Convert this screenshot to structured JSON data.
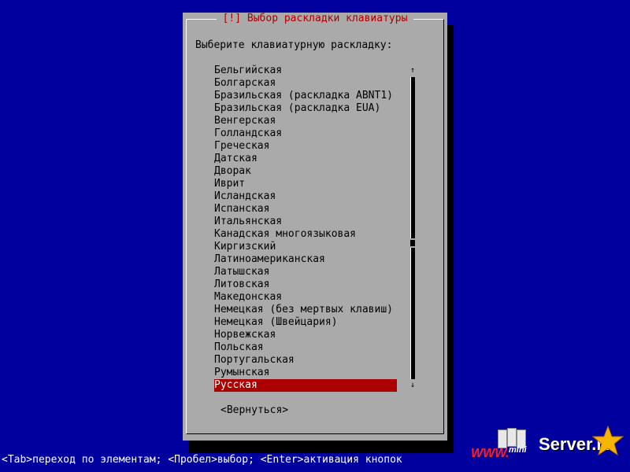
{
  "dialog": {
    "title": "[!] Выбор раскладки клавиатуры",
    "prompt": "Выберите клавиатурную раскладку:",
    "items": [
      "Бельгийская",
      "Болгарская",
      "Бразильская (раскладка ABNT1)",
      "Бразильская (раскладка EUA)",
      "Венгерская",
      "Голландская",
      "Греческая",
      "Датская",
      "Дворак",
      "Иврит",
      "Исландская",
      "Испанская",
      "Итальянская",
      "Канадская многоязыковая",
      "Киргизский",
      "Латиноамериканская",
      "Латышская",
      "Литовская",
      "Македонская",
      "Немецкая (без мертвых клавиш)",
      "Немецкая (Швейцария)",
      "Норвежская",
      "Польская",
      "Португальская",
      "Румынская",
      "Русская"
    ],
    "selected_item": "Русская",
    "scroll_up_glyph": "↑",
    "scroll_down_glyph": "↓",
    "scroll_position": 0.55,
    "back_button": "<Вернуться>"
  },
  "status_bar": {
    "text": "<Tab>переход по элементам; <Пробел>выбор; <Enter>активация кнопок"
  },
  "watermark": {
    "www": "WWW.",
    "mini": "mini",
    "server": "Server.ru",
    "server_icon": "server-rack-icon",
    "star_icon": "star-icon"
  },
  "colors": {
    "background": "#00009f",
    "dialog": "#aaaaaa",
    "title": "#aa0000",
    "selection": "#aa0000",
    "status_text": "#ffffff"
  }
}
